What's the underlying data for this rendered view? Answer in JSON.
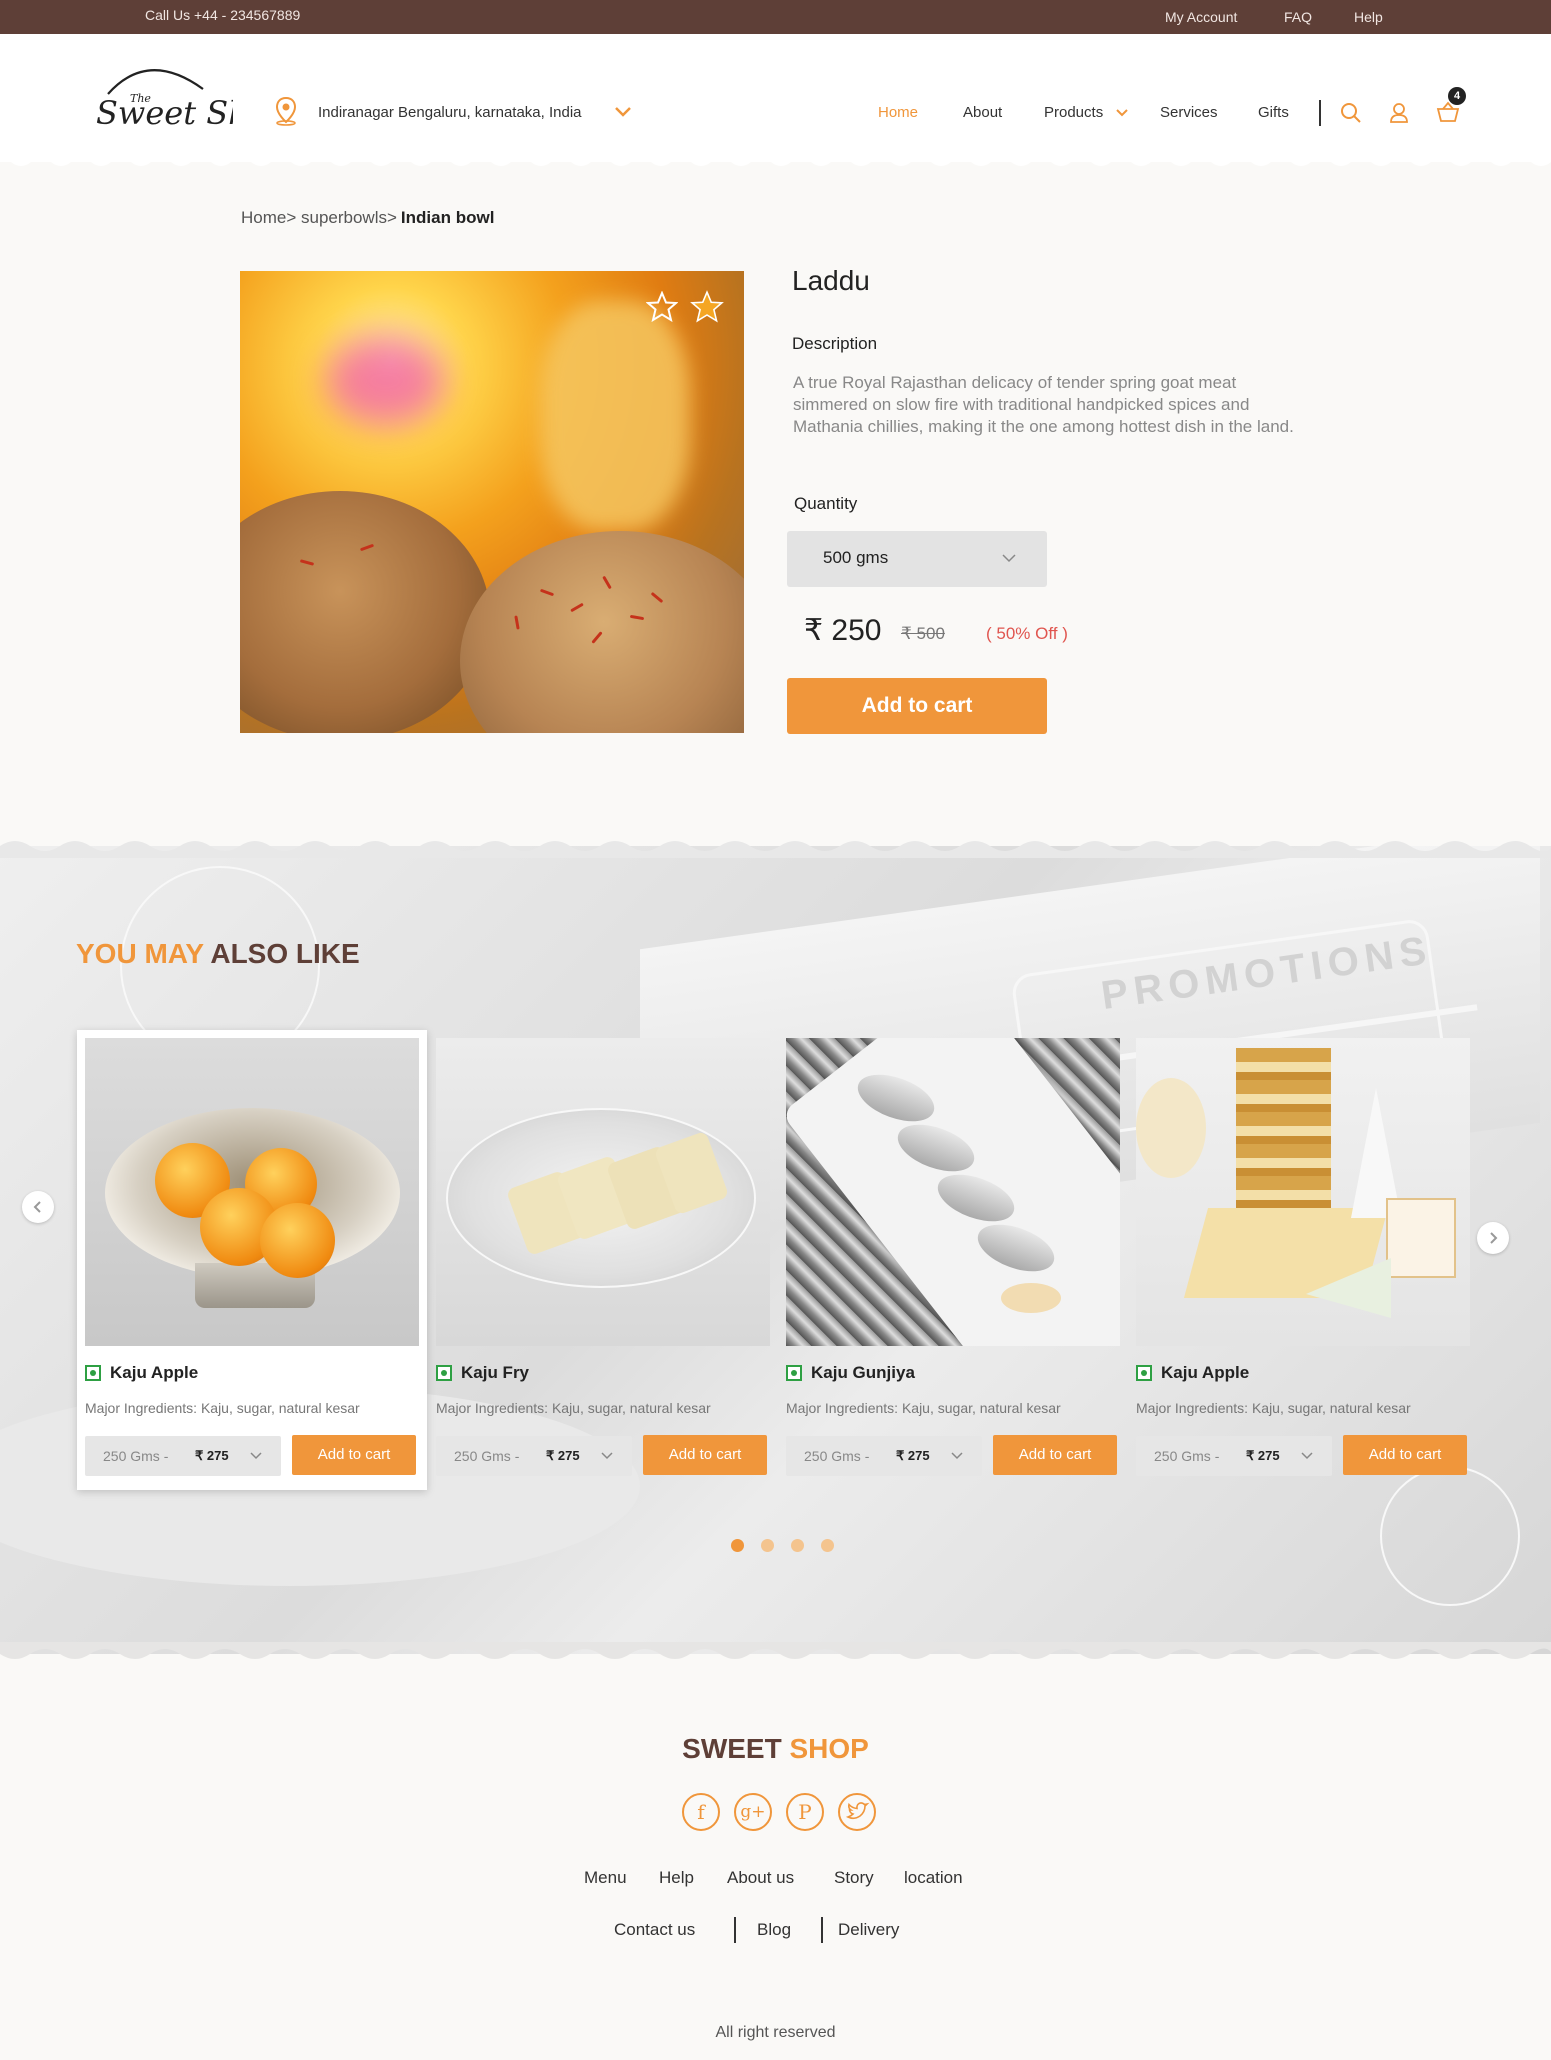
{
  "topbar": {
    "call": "Call Us +44 - 234567889",
    "links": [
      "My Account",
      "FAQ",
      "Help"
    ]
  },
  "header": {
    "logo_text": "The Sweet Shop",
    "location": "Indiranagar Bengaluru, karnataka, India",
    "nav": [
      "Home",
      "About",
      "Products",
      "Services",
      "Gifts"
    ],
    "cart_count": "4"
  },
  "breadcrumb": {
    "path": "Home> superbowls>",
    "current": "Indian bowl"
  },
  "product": {
    "name": "Laddu",
    "description_heading": "Description",
    "description": "A true Royal Rajasthan delicacy of tender spring goat meat simmered on slow fire with traditional handpicked spices and Mathania chillies, making it the one among hottest dish in the land.",
    "quantity_heading": "Quantity",
    "quantity_value": "500 gms",
    "price": "₹ 250",
    "old_price": "₹ 500",
    "discount": "( 50% Off )",
    "add_to_cart": "Add to cart"
  },
  "related": {
    "title_part1": "YOU MAY",
    "title_part2": "ALSO LIKE",
    "cards": [
      {
        "name": "Kaju Apple",
        "ingredients": "Major Ingredients: Kaju, sugar, natural kesar",
        "weight": "250 Gms -",
        "price": "₹ 275",
        "button": "Add to cart"
      },
      {
        "name": "Kaju Fry",
        "ingredients": "Major Ingredients: Kaju, sugar, natural kesar",
        "weight": "250 Gms -",
        "price": "₹ 275",
        "button": "Add to cart"
      },
      {
        "name": "Kaju Gunjiya",
        "ingredients": "Major Ingredients: Kaju, sugar, natural kesar",
        "weight": "250 Gms -",
        "price": "₹ 275",
        "button": "Add to cart"
      },
      {
        "name": "Kaju Apple",
        "ingredients": "Major Ingredients: Kaju, sugar, natural kesar",
        "weight": "250 Gms -",
        "price": "₹ 275",
        "button": "Add to cart"
      }
    ],
    "background_text": "PROMOTIONS"
  },
  "footer": {
    "brand_part1": "SWEET",
    "brand_part2": "SHOP",
    "social": [
      "facebook-icon",
      "google-plus-icon",
      "pinterest-icon",
      "twitter-icon"
    ],
    "links_row1": [
      "Menu",
      "Help",
      "About us",
      "Story",
      "location"
    ],
    "links_row2": [
      "Contact us",
      "Blog",
      "Delivery"
    ],
    "copyright": "All right reserved"
  },
  "colors": {
    "accent": "#f0963b",
    "brand_brown": "#5e3f37",
    "discount_red": "#e0554f",
    "veg_green": "#2ea043"
  }
}
